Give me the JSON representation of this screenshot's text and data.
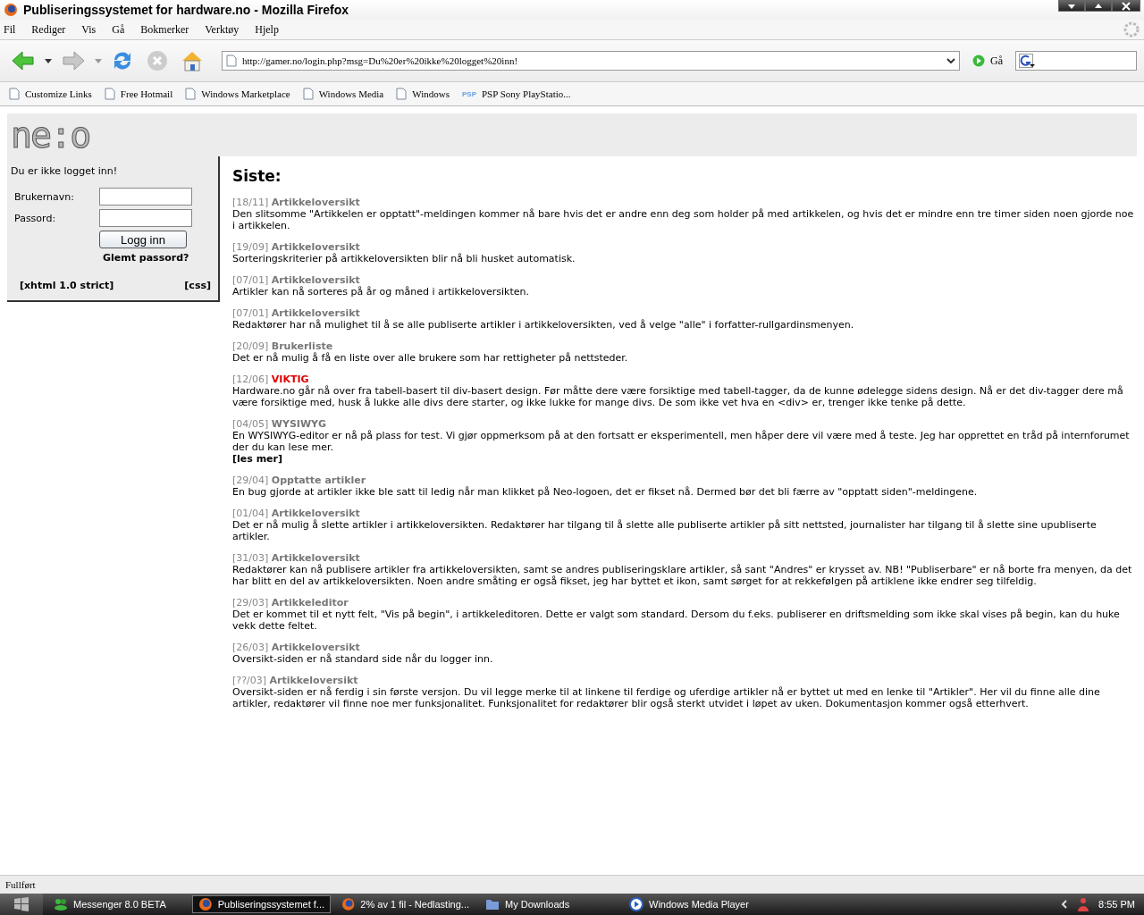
{
  "window": {
    "title": "Publiseringssystemet for hardware.no - Mozilla Firefox"
  },
  "menu": [
    "Fil",
    "Rediger",
    "Vis",
    "Gå",
    "Bokmerker",
    "Verktøy",
    "Hjelp"
  ],
  "address": {
    "value": "http://gamer.no/login.php?msg=Du%20er%20ikke%20logget%20inn!"
  },
  "go_label": "Gå",
  "bookmarks": [
    {
      "label": "Customize Links",
      "kind": "page"
    },
    {
      "label": "Free Hotmail",
      "kind": "page"
    },
    {
      "label": "Windows Marketplace",
      "kind": "page"
    },
    {
      "label": "Windows Media",
      "kind": "page"
    },
    {
      "label": "Windows",
      "kind": "page"
    },
    {
      "label": "PSP Sony PlayStatio...",
      "kind": "psp",
      "badge": "PSP"
    }
  ],
  "logo": "ne:o",
  "login": {
    "message": "Du er ikke logget inn!",
    "username_label": "Brukernavn:",
    "password_label": "Passord:",
    "submit": "Logg inn",
    "forgot": "Glemt passord?",
    "footer_links": [
      "[xhtml 1.0 strict]",
      "[css]"
    ]
  },
  "news": {
    "heading": "Siste:",
    "items": [
      {
        "date": "[18/11]",
        "title": "Artikkeloversikt",
        "important": false,
        "body": "Den slitsomme \"Artikkelen er opptatt\"-meldingen kommer nå bare hvis det er andre enn deg som holder på med artikkelen, og hvis det er mindre enn tre timer siden noen gjorde noe i artikkelen."
      },
      {
        "date": "[19/09]",
        "title": "Artikkeloversikt",
        "important": false,
        "body": "Sorteringskriterier på artikkeloversikten blir nå bli husket automatisk."
      },
      {
        "date": "[07/01]",
        "title": "Artikkeloversikt",
        "important": false,
        "body": "Artikler kan nå sorteres på år og måned i artikkeloversikten."
      },
      {
        "date": "[07/01]",
        "title": "Artikkeloversikt",
        "important": false,
        "body": "Redaktører har nå mulighet til å se alle publiserte artikler i artikkeloversikten, ved å velge \"alle\" i forfatter-rullgardinsmenyen."
      },
      {
        "date": "[20/09]",
        "title": "Brukerliste",
        "important": false,
        "body": "Det er nå mulig å få en liste over alle brukere som har rettigheter på nettsteder."
      },
      {
        "date": "[12/06]",
        "title": "VIKTIG",
        "important": true,
        "body": "Hardware.no går nå over fra tabell-basert til div-basert design. Før måtte dere være forsiktige med tabell-tagger, da de kunne ødelegge sidens design. Nå er det div-tagger dere må være forsiktige med, husk å lukke alle divs dere starter, og ikke lukke for mange divs. De som ikke vet hva en <div> er, trenger ikke tenke på dette."
      },
      {
        "date": "[04/05]",
        "title": "WYSIWYG",
        "important": false,
        "body": "En WYSIWYG-editor er nå på plass for test. Vi gjør oppmerksom på at den fortsatt er eksperimentell, men håper dere vil være med å teste. Jeg har opprettet en tråd på internforumet der du kan lese mer.",
        "link": "[les mer]"
      },
      {
        "date": "[29/04]",
        "title": "Opptatte artikler",
        "important": false,
        "body": "En bug gjorde at artikler ikke ble satt til ledig når man klikket på Neo-logoen, det er fikset nå. Dermed bør det bli færre av \"opptatt siden\"-meldingene."
      },
      {
        "date": "[01/04]",
        "title": "Artikkeloversikt",
        "important": false,
        "body": "Det er nå mulig å slette artikler i artikkeloversikten. Redaktører har tilgang til å slette alle publiserte artikler på sitt nettsted, journalister har tilgang til å slette sine upubliserte artikler."
      },
      {
        "date": "[31/03]",
        "title": "Artikkeloversikt",
        "important": false,
        "body": "Redaktører kan nå publisere artikler fra artikkeloversikten, samt se andres publiseringsklare artikler, så sant \"Andres\" er krysset av. NB! \"Publiserbare\" er nå borte fra menyen, da det har blitt en del av artikkeloversikten. Noen andre småting er også fikset, jeg har byttet et ikon, samt sørget for at rekkefølgen på artiklene ikke endrer seg tilfeldig."
      },
      {
        "date": "[29/03]",
        "title": "Artikkeleditor",
        "important": false,
        "body": "Det er kommet til et nytt felt, \"Vis på begin\", i artikkeleditoren. Dette er valgt som standard. Dersom du f.eks. publiserer en driftsmelding som ikke skal vises på begin, kan du huke vekk dette feltet."
      },
      {
        "date": "[26/03]",
        "title": "Artikkeloversikt",
        "important": false,
        "body": "Oversikt-siden er nå standard side når du logger inn."
      },
      {
        "date": "[??/03]",
        "title": "Artikkeloversikt",
        "important": false,
        "body": "Oversikt-siden er nå ferdig i sin første versjon. Du vil legge merke til at linkene til ferdige og uferdige artikler nå er byttet ut med en lenke til \"Artikler\". Her vil du finne alle dine artikler, redaktører vil finne noe mer funksjonalitet. Funksjonalitet for redaktører blir også sterkt utvidet i løpet av uken. Dokumentasjon kommer også etterhvert."
      }
    ]
  },
  "status_bar": {
    "text": "Fullført"
  },
  "taskbar": {
    "items": [
      {
        "label": "Messenger 8.0 BETA",
        "kind": "messenger",
        "selected": false
      },
      {
        "label": "Publiseringssystemet f...",
        "kind": "firefox",
        "selected": true
      },
      {
        "label": "2% av 1 fil - Nedlasting...",
        "kind": "firefox",
        "selected": false
      },
      {
        "label": "My Downloads",
        "kind": "folder",
        "selected": false
      },
      {
        "label": "Windows Media Player",
        "kind": "media",
        "selected": false
      }
    ],
    "clock": "8:55 PM"
  }
}
